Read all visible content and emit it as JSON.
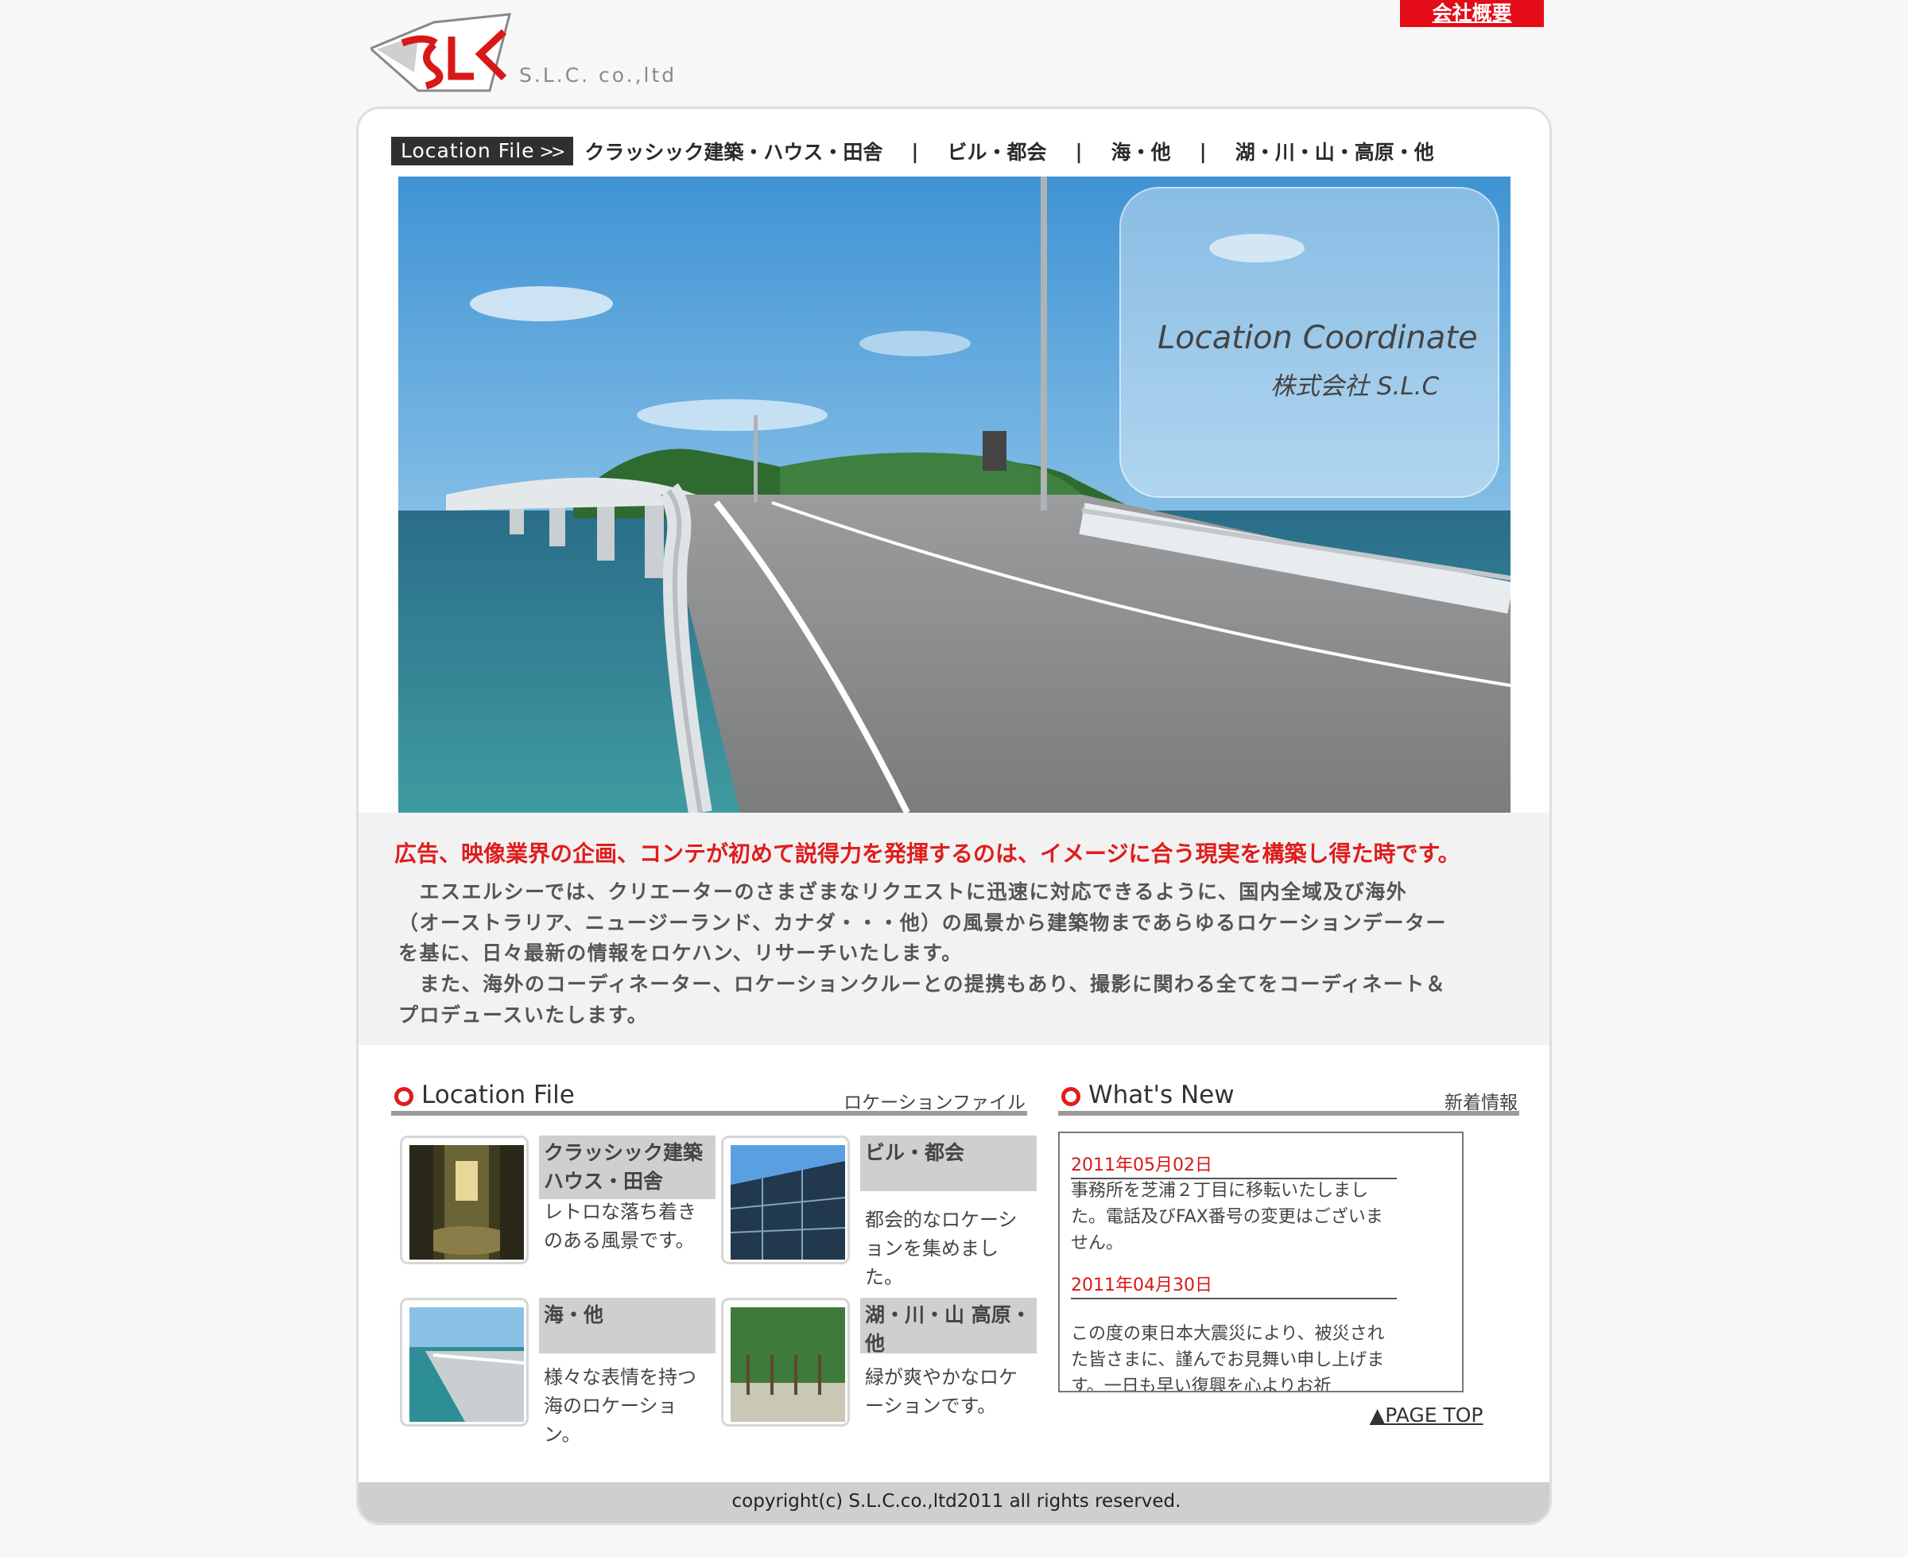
{
  "header": {
    "company_name": "S.L.C. co.,ltd",
    "top_link": "会社概要",
    "logo_text": "SLC"
  },
  "nav": {
    "tag": "Location File",
    "items": [
      "クラッシック建築・ハウス・田舎",
      "ビル・都会",
      "海・他",
      "湖・川・山・高原・他"
    ],
    "separator": "|"
  },
  "hero": {
    "title": "Location Coordinate",
    "subtitle": "株式会社 S.L.C"
  },
  "intro": {
    "lead": "広告、映像業界の企画、コンテが初めて説得力を発揮するのは、イメージに合う現実を構築し得た時です。",
    "lines": [
      "　エスエルシーでは、クリエーターのさまざまなリクエストに迅速に対応できるように、国内全域及び海外",
      "（オーストラリア、ニュージーランド、カナダ・・・他）の風景から建築物まであらゆるロケーションデーター",
      "を基に、日々最新の情報をロケハン、リサーチいたします。",
      "　また、海外のコーディネーター、ロケーションクルーとの提携もあり、撮影に関わる全てをコーディネート＆",
      "プロデュースいたします。"
    ]
  },
  "location_section": {
    "title_en": "Location File",
    "title_jp": "ロケーションファイル",
    "items": [
      {
        "title": "クラッシック建築ハウス・田舎",
        "desc": "レトロな落ち着きのある風景です。"
      },
      {
        "title": "ビル・都会",
        "desc": "都会的なロケーションを集めました。"
      },
      {
        "title": "海・他",
        "desc": "様々な表情を持つ海のロケーション。"
      },
      {
        "title": "湖・川・山 高原・他",
        "desc": "緑が爽やかなロケーションです。"
      }
    ]
  },
  "news_section": {
    "title_en": "What's New",
    "title_jp": "新着情報",
    "entries": [
      {
        "date": "2011年05月02日",
        "text": "事務所を芝浦２丁目に移転いたしました。電話及びFAX番号の変更はございません。"
      },
      {
        "date": "2011年04月30日",
        "text": "この度の東日本大震災により、被災された皆さまに、謹んでお見舞い申し上げます。一日も早い復興を心よりお祈"
      }
    ]
  },
  "page_top": "▲PAGE TOP",
  "footer": "copyright(c) S.L.C.co.,ltd2011 all rights reserved.",
  "colors": {
    "accent_red": "#e01c1c",
    "background": "#f7f7f7",
    "band_gray": "#f2f2f2"
  }
}
